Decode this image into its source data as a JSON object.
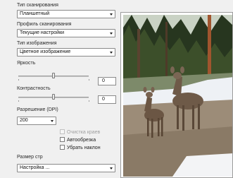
{
  "scan": {
    "scan_type_label": "Тип сканирования",
    "scan_type_value": "Планшетный",
    "profile_label": "Профиль сканирования",
    "profile_value": "Текущие настройки",
    "image_type_label": "Тип изображения",
    "image_type_value": "Цветное изображение",
    "brightness_label": "Яркость",
    "brightness_value": "0",
    "contrast_label": "Контрастность",
    "contrast_value": "0",
    "resolution_label": "Разрешение (DPI)",
    "resolution_value": "200",
    "edge_cleanup_label": "Очистка краев",
    "autocrop_label": "Автообрезка",
    "deskew_label": "Убрать наклон",
    "page_size_label": "Размер стр",
    "page_size_value": "Настройка ..."
  },
  "sliders": {
    "brightness_level": 0.5,
    "contrast_level": 0.5
  },
  "checkboxes": {
    "edge_cleanup_enabled": false,
    "autocrop_checked": false,
    "deskew_checked": false
  },
  "preview": {
    "subject_icon": "deer-photo"
  },
  "colors": {
    "panel_bg": "#f0f0f0",
    "border": "#8a8a8a",
    "disabled_text": "#a0a0a0"
  }
}
